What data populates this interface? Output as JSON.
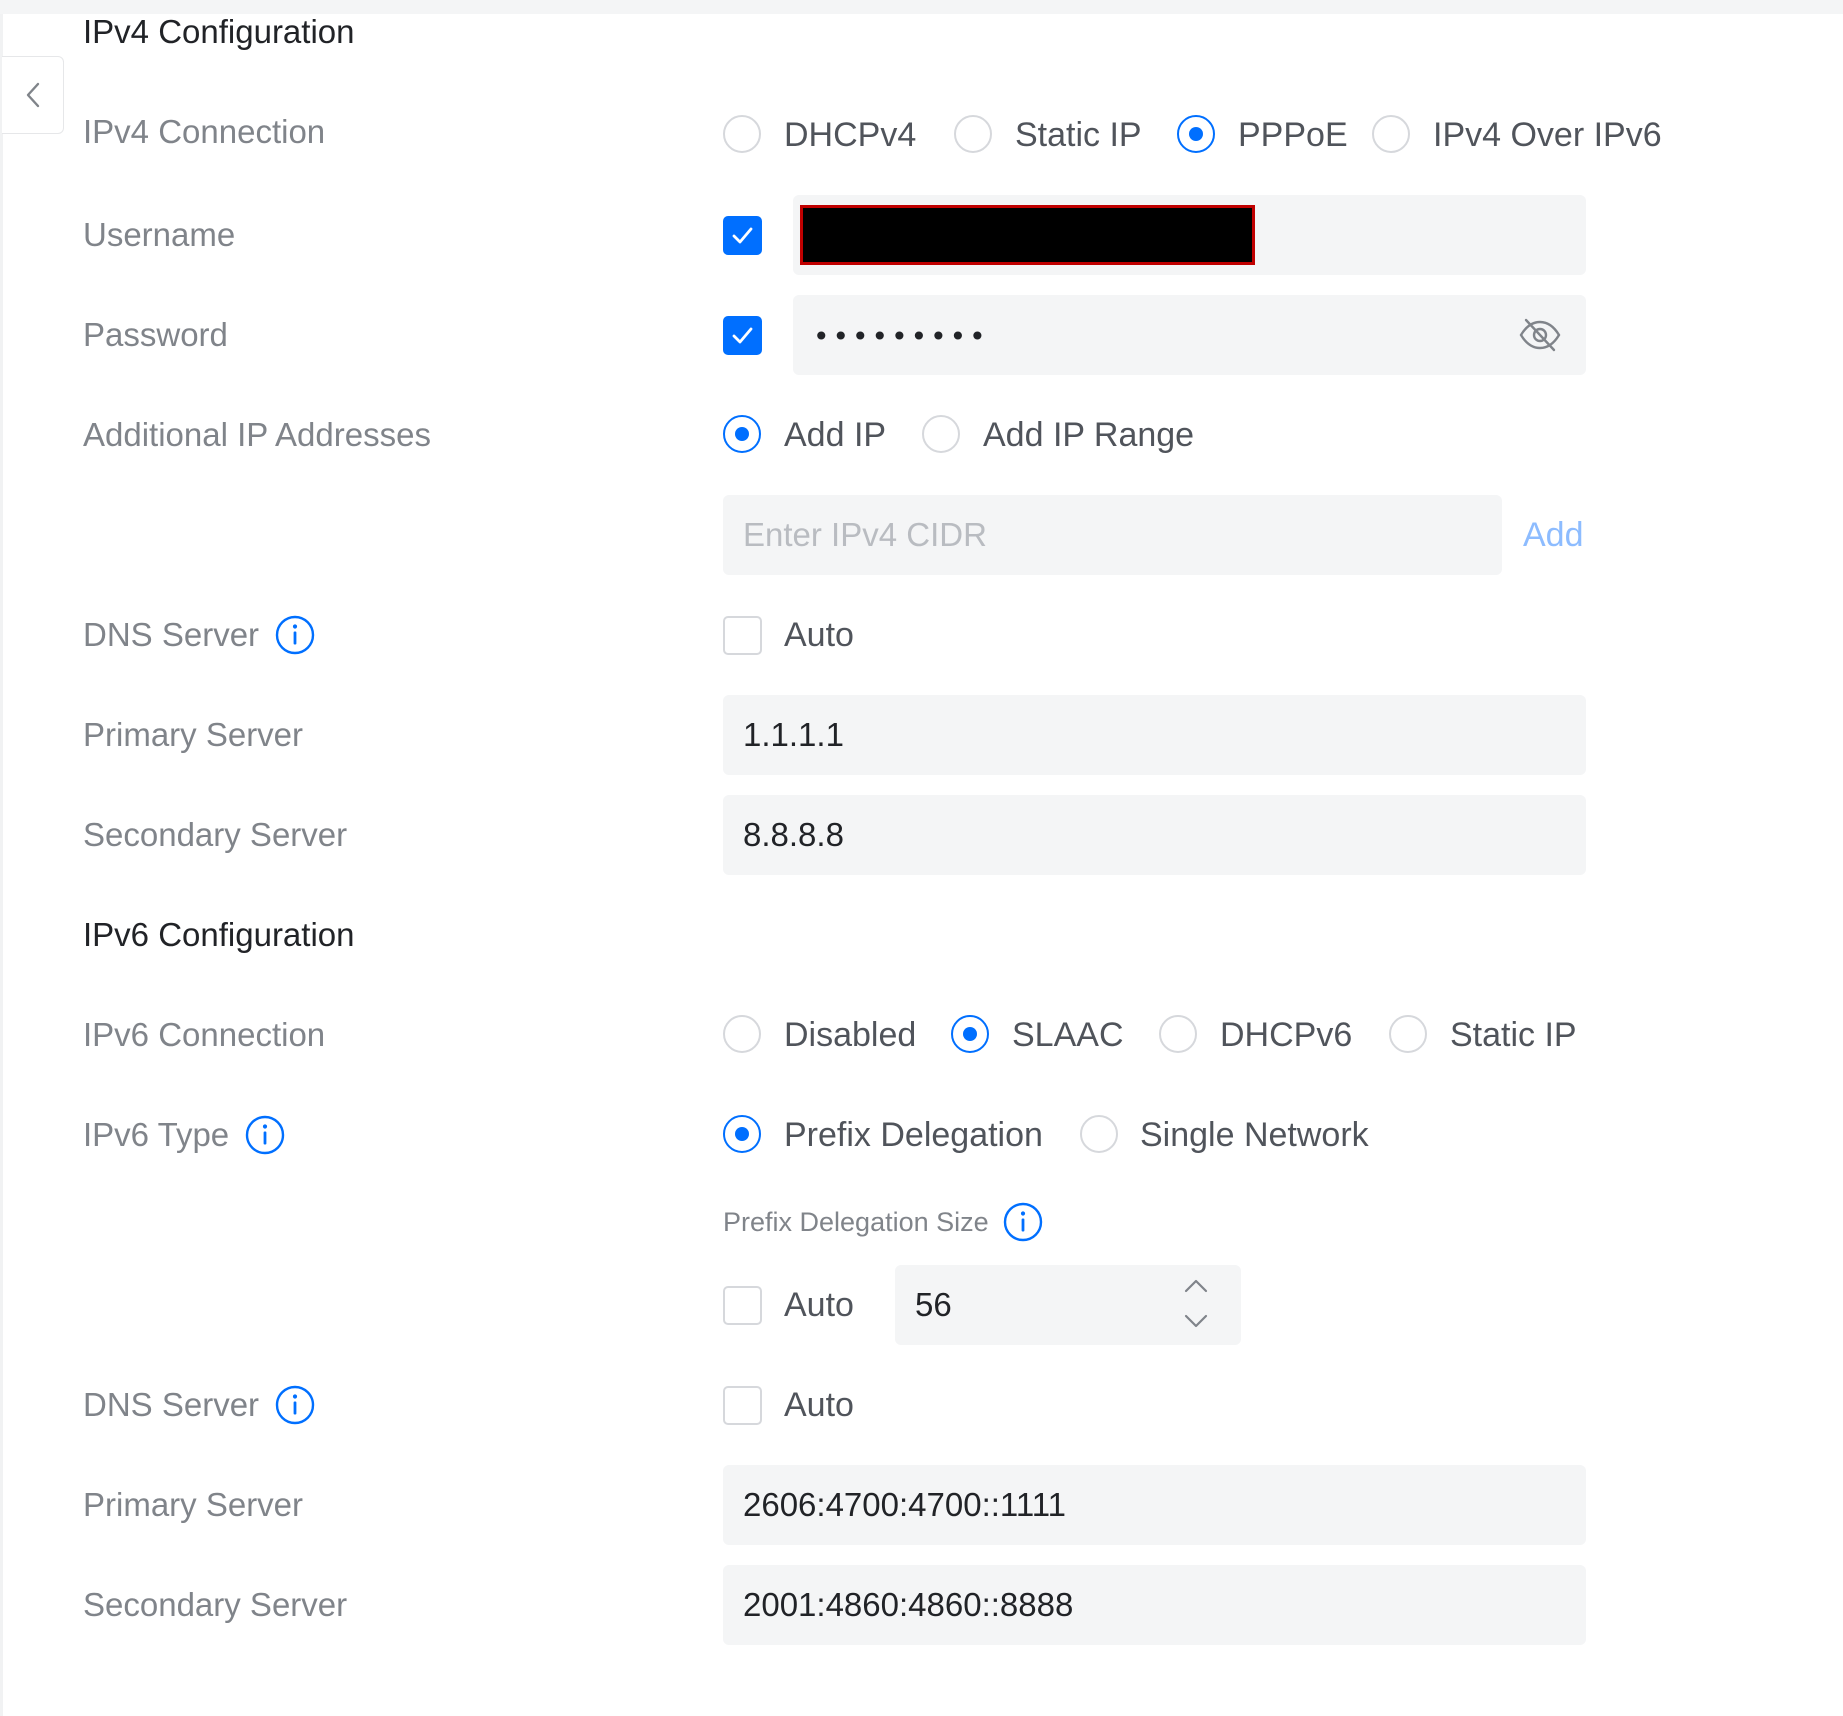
{
  "ipv4": {
    "title": "IPv4 Configuration",
    "connection_label": "IPv4 Connection",
    "connection_options": [
      "DHCPv4",
      "Static IP",
      "PPPoE",
      "IPv4 Over IPv6"
    ],
    "connection_selected": "PPPoE",
    "username_label": "Username",
    "username_enabled": true,
    "password_label": "Password",
    "password_enabled": true,
    "password_masked": "•••••••••",
    "additional_label": "Additional IP Addresses",
    "additional_options": [
      "Add IP",
      "Add IP Range"
    ],
    "additional_selected": "Add IP",
    "cidr_placeholder": "Enter IPv4 CIDR",
    "add_link": "Add",
    "dns_label": "DNS Server",
    "dns_auto_label": "Auto",
    "dns_auto_checked": false,
    "primary_label": "Primary Server",
    "primary_value": "1.1.1.1",
    "secondary_label": "Secondary Server",
    "secondary_value": "8.8.8.8"
  },
  "ipv6": {
    "title": "IPv6 Configuration",
    "connection_label": "IPv6 Connection",
    "connection_options": [
      "Disabled",
      "SLAAC",
      "DHCPv6",
      "Static IP"
    ],
    "connection_selected": "SLAAC",
    "type_label": "IPv6 Type",
    "type_options": [
      "Prefix Delegation",
      "Single Network"
    ],
    "type_selected": "Prefix Delegation",
    "prefix_size_label": "Prefix Delegation Size",
    "prefix_auto_label": "Auto",
    "prefix_auto_checked": false,
    "prefix_value": "56",
    "dns_label": "DNS Server",
    "dns_auto_label": "Auto",
    "dns_auto_checked": false,
    "primary_label": "Primary Server",
    "primary_value": "2606:4700:4700::1111",
    "secondary_label": "Secondary Server",
    "secondary_value": "2001:4860:4860::8888"
  },
  "colors": {
    "accent": "#006fff",
    "link_light": "#8dbcff",
    "label_gray": "#80848a",
    "field_bg": "#f4f5f6",
    "redaction": "#000000"
  },
  "icons": [
    "chevron-left-icon",
    "info-icon",
    "eye-off-icon",
    "check-icon",
    "chevron-up-icon",
    "chevron-down-icon"
  ]
}
